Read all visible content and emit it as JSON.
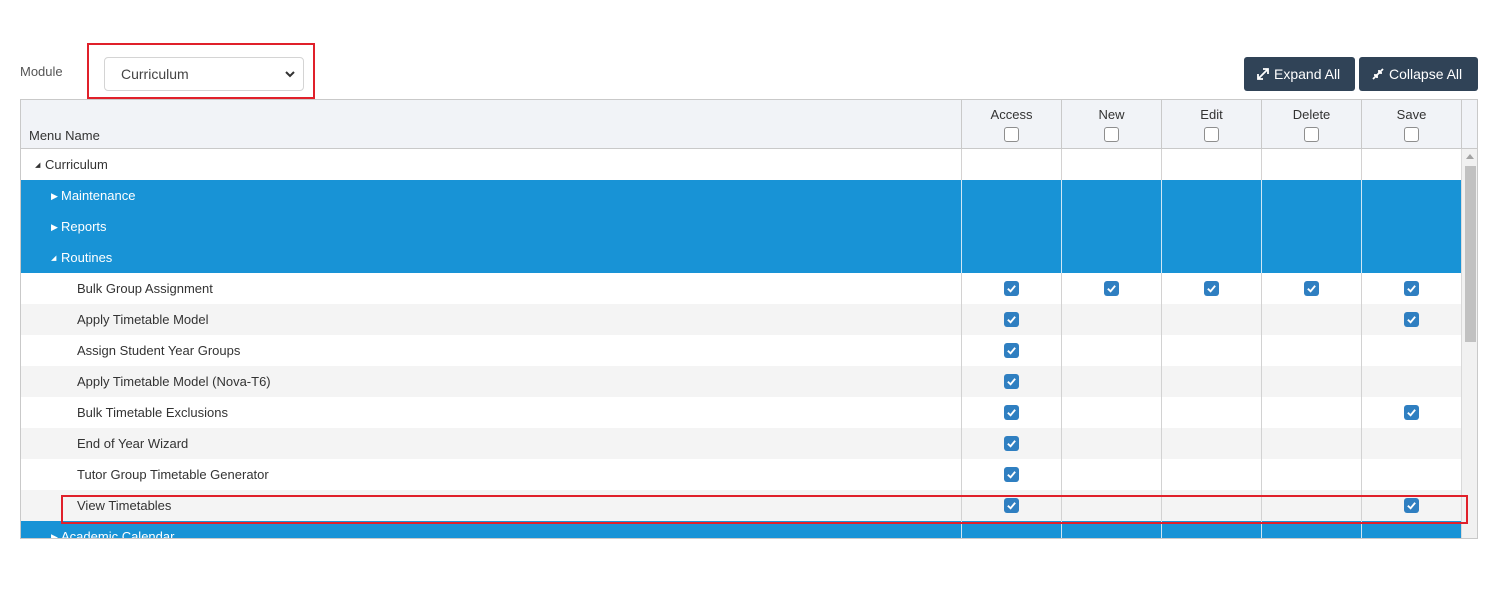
{
  "filter": {
    "module_label": "Module",
    "module_value": "Curriculum"
  },
  "toolbar": {
    "expand_label": "Expand All",
    "collapse_label": "Collapse All"
  },
  "grid": {
    "menu_header": "Menu Name",
    "columns": [
      "Access",
      "New",
      "Edit",
      "Delete",
      "Save"
    ],
    "rows": [
      {
        "label": "Curriculum",
        "level": 0,
        "kind": "group",
        "state": "expanded",
        "style": "white",
        "checks": []
      },
      {
        "label": "Maintenance",
        "level": 1,
        "kind": "group",
        "state": "collapsed",
        "style": "blue",
        "checks": []
      },
      {
        "label": "Reports",
        "level": 1,
        "kind": "group",
        "state": "collapsed",
        "style": "blue",
        "checks": []
      },
      {
        "label": "Routines",
        "level": 1,
        "kind": "group",
        "state": "expanded",
        "style": "blue",
        "checks": []
      },
      {
        "label": "Bulk Group Assignment",
        "level": 2,
        "kind": "item",
        "style": "white",
        "checks": [
          true,
          true,
          true,
          true,
          true
        ]
      },
      {
        "label": "Apply Timetable Model",
        "level": 2,
        "kind": "item",
        "style": "alt",
        "checks": [
          true,
          false,
          false,
          false,
          true
        ]
      },
      {
        "label": "Assign Student Year Groups",
        "level": 2,
        "kind": "item",
        "style": "white",
        "checks": [
          true,
          false,
          false,
          false,
          false
        ]
      },
      {
        "label": "Apply Timetable Model (Nova-T6)",
        "level": 2,
        "kind": "item",
        "style": "alt",
        "checks": [
          true,
          false,
          false,
          false,
          false
        ]
      },
      {
        "label": "Bulk Timetable Exclusions",
        "level": 2,
        "kind": "item",
        "style": "white",
        "checks": [
          true,
          false,
          false,
          false,
          true
        ]
      },
      {
        "label": "End of Year Wizard",
        "level": 2,
        "kind": "item",
        "style": "alt",
        "checks": [
          true,
          false,
          false,
          false,
          false
        ]
      },
      {
        "label": "Tutor Group Timetable Generator",
        "level": 2,
        "kind": "item",
        "style": "white",
        "checks": [
          true,
          false,
          false,
          false,
          false
        ]
      },
      {
        "label": "View Timetables",
        "level": 2,
        "kind": "item",
        "style": "alt",
        "checks": [
          true,
          false,
          false,
          false,
          true
        ]
      },
      {
        "label": "Academic Calendar",
        "level": 1,
        "kind": "group",
        "state": "collapsed",
        "style": "blue",
        "checks": []
      }
    ]
  },
  "colors": {
    "accent_blue": "#1893d6",
    "button_dark": "#304357",
    "checkbox_blue": "#2f7fc1",
    "highlight_red": "#e0202a"
  }
}
